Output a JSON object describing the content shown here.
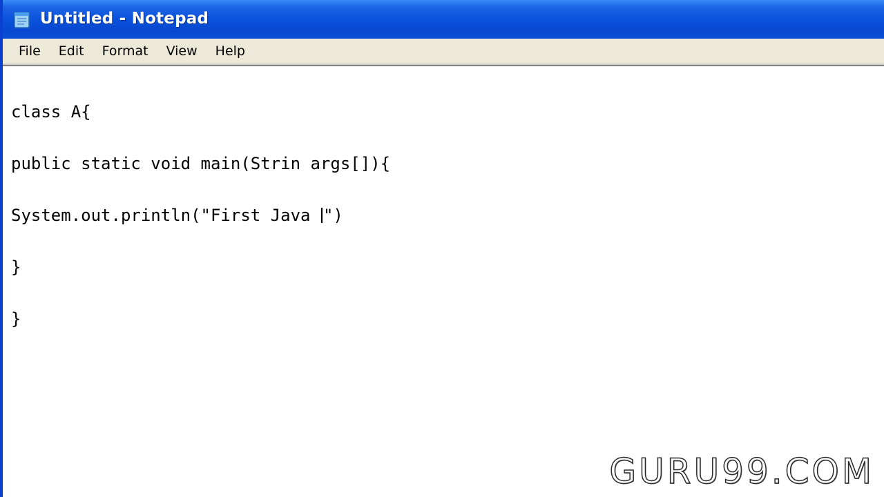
{
  "window": {
    "title": "Untitled - Notepad",
    "app_icon": "notepad-icon"
  },
  "menu": {
    "items": [
      "File",
      "Edit",
      "Format",
      "View",
      "Help"
    ]
  },
  "editor": {
    "lines": [
      "class A{",
      "public static void main(Strin args[]){",
      "System.out.println(\"First Java ",
      "}",
      "}"
    ],
    "line3_after_caret": "\")"
  },
  "watermark": {
    "text": "GURU99.COM"
  },
  "colors": {
    "titlebar": "#0a52dc",
    "menubar": "#ece9d8",
    "editor_bg": "#ffffff"
  }
}
